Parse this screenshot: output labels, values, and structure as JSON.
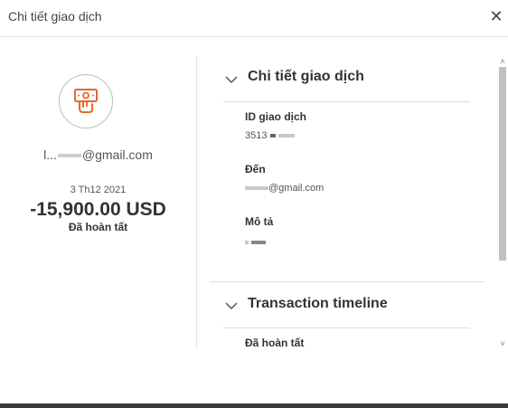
{
  "header": {
    "title": "Chi tiết giao dịch",
    "close_symbol": "✕"
  },
  "summary": {
    "icon": "cash-payment-icon",
    "email_prefix": "l...",
    "email_suffix": "@gmail.com",
    "date": "3 Th12 2021",
    "amount": "-15,900.00 USD",
    "status": "Đã hoàn tất"
  },
  "details": {
    "section_title": "Chi tiết giao dịch",
    "id_label": "ID giao dịch",
    "id_value": "3513",
    "to_label": "Đến",
    "to_value_suffix": "@gmail.com",
    "desc_label": "Mô tả"
  },
  "timeline": {
    "section_title": "Transaction timeline",
    "status": "Đã hoàn tất"
  },
  "colors": {
    "accent": "#e8662c",
    "text": "#333333"
  },
  "scrollbar": {
    "up_symbol": "˄",
    "down_symbol": "˅"
  }
}
